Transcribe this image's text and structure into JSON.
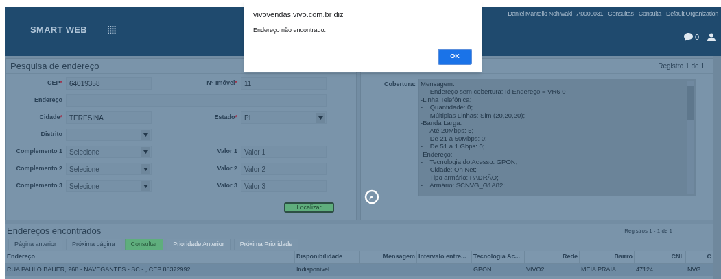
{
  "header": {
    "brand": "SMART WEB",
    "user_info": "Daniel Mantello Nohiwaki - A0000031 - Consultas - Consulta - Default Organization",
    "notifications": "0"
  },
  "dialog": {
    "title": "vivovendas.vivo.com.br diz",
    "message": "Endereço não encontrado.",
    "button": "OK"
  },
  "search_panel": {
    "title": "Pesquisa de endereço",
    "rows": [
      {
        "fields": [
          {
            "kind": "input",
            "label": "CEP",
            "mark": "*",
            "value": "64019358"
          },
          {
            "kind": "input",
            "label": "N° Imóvel",
            "mark": "*",
            "value": "11"
          }
        ]
      },
      {
        "fields": [
          {
            "kind": "wide",
            "label": "Endereço"
          }
        ]
      },
      {
        "fields": [
          {
            "kind": "input",
            "label": "Cidade",
            "mark": "*",
            "value": "TERESINA"
          },
          {
            "kind": "select",
            "label": "Estado",
            "mark": "*",
            "value": "PI"
          }
        ]
      },
      {
        "fields": [
          {
            "kind": "select",
            "label": "Distrito"
          }
        ]
      },
      {
        "fields": [
          {
            "kind": "select",
            "label": "Complemento 1",
            "placeholder": "Selecione"
          },
          {
            "kind": "input",
            "label": "Valor 1",
            "placeholder": "Valor 1"
          }
        ]
      },
      {
        "fields": [
          {
            "kind": "select",
            "label": "Complemento 2",
            "placeholder": "Selecione"
          },
          {
            "kind": "input",
            "label": "Valor 2",
            "placeholder": "Valor 2"
          }
        ]
      },
      {
        "fields": [
          {
            "kind": "select",
            "label": "Complemento 3",
            "placeholder": "Selecione"
          },
          {
            "kind": "input",
            "label": "Valor 3",
            "placeholder": "Valor 3"
          }
        ]
      }
    ],
    "button": "Localizar"
  },
  "detail_panel": {
    "record": "Registro 1 de 1",
    "label": "Cobertura:",
    "lines": [
      "Mensagem:",
      "-    Endereço sem cobertura: Id Endereço = VR6 0",
      "-Linha Telefônica:",
      "-    Quantidade: 0;",
      "-    Múltiplas Linhas: Sim (20,20,20);",
      "-Banda Larga:",
      "-    Até 20Mbps: 5;",
      "-    De 21 a 50Mbps: 0;",
      "-    De 51 a 1 Gbps: 0;",
      "-Endereço:",
      "-    Tecnologia do Acesso: GPON;",
      "-    Cidade: On Net;",
      "-    Tipo armário: PADRÃO;",
      "-    Armário: SCNVG_G1A82;"
    ]
  },
  "results": {
    "title": "Endereços encontrados",
    "count": "Registros 1 - 1 de 1",
    "buttons": [
      {
        "label": "Página anterior",
        "kind": "normal",
        "disabled": false
      },
      {
        "label": "Próxima página",
        "kind": "normal",
        "disabled": false
      },
      {
        "label": "Consultar",
        "kind": "primary",
        "disabled": false
      },
      {
        "label": "Prioridade Anterior",
        "kind": "normal",
        "disabled": true
      },
      {
        "label": "Próxima Prioridade",
        "kind": "normal",
        "disabled": true
      }
    ],
    "table": {
      "columns": [
        "Endereço",
        "Disponibilidade",
        "Mensagem",
        "Intervalo entre...",
        "Tecnologia Ac...",
        "Rede",
        "Bairro",
        "CNL",
        "C"
      ],
      "rows": [
        [
          "RUA PAULO BAUER, 268 - NAVEGANTES - SC - , CEP 88372992",
          "Indisponível",
          null,
          null,
          "GPON",
          "VIVO2",
          "MEIA PRAIA",
          "47124",
          "NVG"
        ]
      ]
    }
  }
}
